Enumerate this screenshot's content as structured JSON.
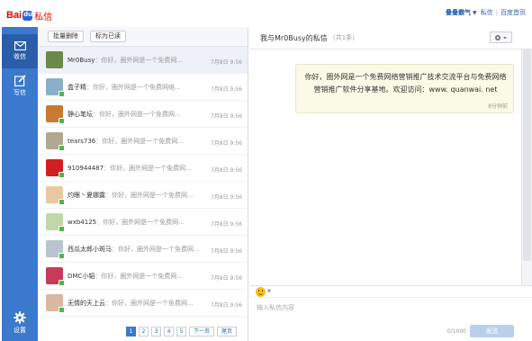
{
  "header": {
    "logo_bai": "Bai",
    "logo_sixin": "私信",
    "username": "叠叠霸气",
    "links": [
      "私信",
      "百度首页"
    ]
  },
  "sidebar": {
    "items": [
      {
        "label": "收信",
        "icon": "envelope-icon"
      },
      {
        "label": "写信",
        "icon": "compose-icon"
      },
      {
        "label": "设置",
        "icon": "gear-icon"
      }
    ]
  },
  "list": {
    "toolbar": {
      "batch_delete": "批量删除",
      "mark_read": "标为已读"
    },
    "conversations": [
      {
        "name": "Mr0Busy",
        "preview": "：你好，圈外网是一个免费网...",
        "time": "7月8日 9:56",
        "color": "#6a8a4a"
      },
      {
        "name": "盒子精",
        "preview": "：你好，圈外网是一个免费网络...",
        "time": "7月8日 9:56",
        "color": "#8ab0c8"
      },
      {
        "name": "静心笔坛",
        "preview": "：你好，圈外网是一个免费网...",
        "time": "7月8日 9:56",
        "color": "#c87a30"
      },
      {
        "name": "tears736",
        "preview": "：你好，圈外网是一个免费网...",
        "time": "7月8日 9:56",
        "color": "#b0a890"
      },
      {
        "name": "910944487",
        "preview": "：你好，圈外网是一个免费网...",
        "time": "7月8日 9:56",
        "color": "#d02020"
      },
      {
        "name": "灼眼丶夏娜露",
        "preview": "：你好，圈外网是一个免费网...",
        "time": "7月8日 9:56",
        "color": "#e8c8a0"
      },
      {
        "name": "wxb4125",
        "preview": "：你好，圈外网是一个免费网...",
        "time": "7月8日 9:56",
        "color": "#c0d8a8"
      },
      {
        "name": "西瓜太郎小斑马",
        "preview": "：你好，圈外网是一个免费网...",
        "time": "7月8日 9:56",
        "color": "#b8c4d0"
      },
      {
        "name": "DMC小韬",
        "preview": "：你好，圈外网是一个免费网...",
        "time": "7月8日 9:56",
        "color": "#c83a5a"
      },
      {
        "name": "无情的天上云",
        "preview": "：你好，圈外网是一个免费网...",
        "time": "7月8日 9:56",
        "color": "#d8b8a0"
      }
    ],
    "pager": {
      "pages": [
        "1",
        "2",
        "3",
        "4",
        "5"
      ],
      "current": "1",
      "next": "下一页",
      "last": "尾页"
    }
  },
  "chat": {
    "title": "我与Mr0Busy的私信",
    "count": "（共1条）",
    "message": "你好，圈外网是一个免费网络营销推广技术交流平台与免费网络营销推广软件分享基地。欢迎访问：www. quanwai. net",
    "message_time": "8分钟前",
    "input_placeholder": "输入私信内容",
    "counter": "0/1000",
    "send": "发送"
  }
}
